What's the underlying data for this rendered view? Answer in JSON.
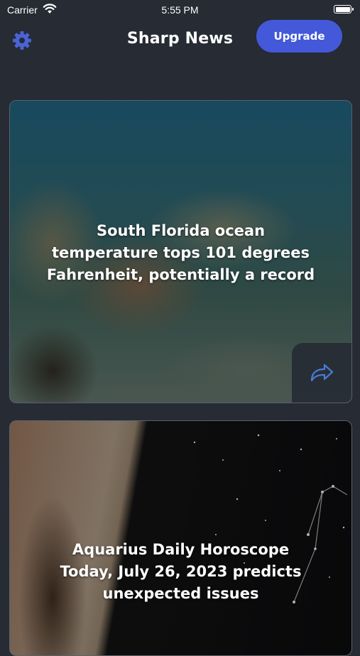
{
  "status_bar": {
    "carrier": "Carrier",
    "time": "5:55 PM"
  },
  "header": {
    "title": "Sharp News",
    "upgrade_label": "Upgrade",
    "settings_icon": "gear-icon",
    "accent_color": "#4359d9"
  },
  "articles": [
    {
      "title": "South Florida ocean temperature tops 101 degrees Fahrenheit, potentially a record",
      "title_lines": [
        "South Florida ocean",
        "temperature tops 101 degrees",
        "Fahrenheit, potentially a record"
      ],
      "share_icon": "share-icon"
    },
    {
      "title": "Aquarius Daily Horoscope Today, July 26, 2023 predicts unexpected issues",
      "title_lines": [
        "Aquarius Daily Horoscope",
        "Today, July 26, 2023 predicts",
        "unexpected issues"
      ]
    }
  ]
}
